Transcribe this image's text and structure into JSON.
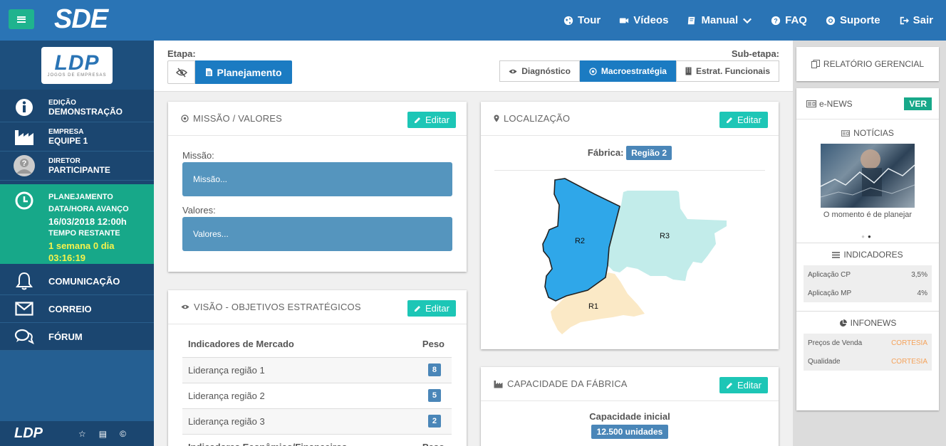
{
  "header": {
    "brand": "SDE",
    "nav": [
      {
        "label": "Tour",
        "icon": "globe-icon"
      },
      {
        "label": "Vídeos",
        "icon": "video-camera-icon"
      },
      {
        "label": "Manual",
        "icon": "book-icon"
      },
      {
        "label": "FAQ",
        "icon": "question-circle-icon"
      },
      {
        "label": "Suporte",
        "icon": "lifebuoy-icon"
      },
      {
        "label": "Sair",
        "icon": "sign-out-icon"
      }
    ]
  },
  "sidebar": {
    "logo_text": "LDP",
    "logo_sub": "JOGOS DE EMPRESAS",
    "edicao": {
      "label": "EDIÇÃO",
      "value": "DEMONSTRAÇÃO"
    },
    "empresa": {
      "label": "EMPRESA",
      "value": "EQUIPE 1"
    },
    "diretor": {
      "label": "DIRETOR",
      "value": "PARTICIPANTE"
    },
    "status": {
      "phase": "PLANEJAMENTO",
      "advance_label": "DATA/HORA AVANÇO",
      "advance_value": "16/03/2018 12:00h",
      "remaining_label": "TEMPO RESTANTE",
      "remaining_line1": "1 semana 0 dia",
      "remaining_line2": "03:16:19"
    },
    "links": [
      "COMUNICAÇÃO",
      "CORREIO",
      "FÓRUM"
    ],
    "footer_logo": "LDP"
  },
  "stage": {
    "etapa_label": "Etapa:",
    "etapa_active": "Planejamento",
    "subetapa_label": "Sub-etapa:",
    "subetapas": [
      "Diagnóstico",
      "Macroestratégia",
      "Estrat. Funcionais"
    ],
    "active_subetapa": "Macroestratégia"
  },
  "missao": {
    "title": "MISSÃO / VALORES",
    "edit": "Editar",
    "missao_label": "Missão:",
    "missao_value": "Missão...",
    "valores_label": "Valores:",
    "valores_value": "Valores..."
  },
  "visao": {
    "title": "VISÃO - OBJETIVOS ESTRATÉGICOS",
    "edit": "Editar",
    "table_header": "Indicadores de Mercado",
    "peso_header": "Peso",
    "rows": [
      {
        "name": "Liderança região 1",
        "peso": "8"
      },
      {
        "name": "Liderança região 2",
        "peso": "5"
      },
      {
        "name": "Liderança região 3",
        "peso": "2"
      }
    ],
    "table_header2": "Indicadores Econômico/Financeiros",
    "peso_header2": "Peso"
  },
  "localizacao": {
    "title": "LOCALIZAÇÃO",
    "edit": "Editar",
    "fabrica_label": "Fábrica:",
    "fabrica_value": "Região 2",
    "regions": {
      "r1": "R1",
      "r2": "R2",
      "r3": "R3"
    },
    "colors": {
      "r1": "#fbe9c6",
      "r2": "#2fa7e9",
      "r3": "#c2ecea"
    }
  },
  "capacidade": {
    "title": "CAPACIDADE DA FÁBRICA",
    "edit": "Editar",
    "label": "Capacidade inicial",
    "value": "12.500 unidades"
  },
  "right": {
    "relatorio": "RELATÓRIO GERENCIAL",
    "enews": "e-NEWS",
    "ver": "VER",
    "noticias": "NOTÍCIAS",
    "caption": "O momento é de planejar",
    "indicadores_title": "INDICADORES",
    "indicadores": [
      {
        "label": "Aplicação CP",
        "value": "3,5%"
      },
      {
        "label": "Aplicação MP",
        "value": "4%"
      }
    ],
    "infonews_title": "INFONEWS",
    "infonews": [
      {
        "label": "Preços de Venda",
        "value": "CORTESIA"
      },
      {
        "label": "Qualidade",
        "value": "CORTESIA"
      }
    ]
  }
}
